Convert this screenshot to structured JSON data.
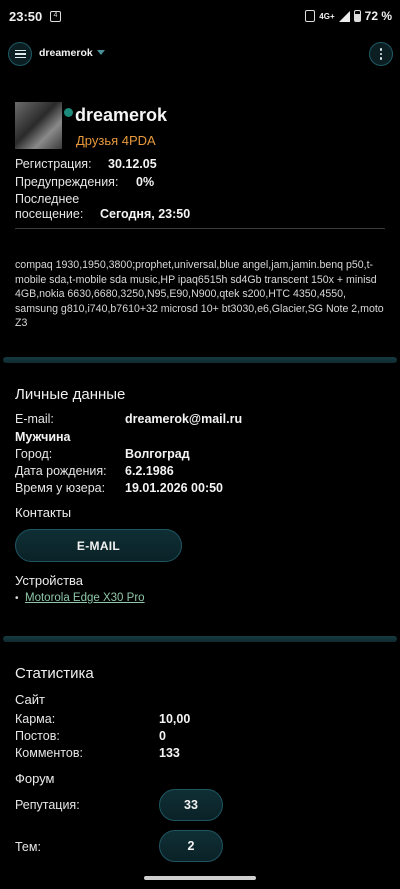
{
  "status_bar": {
    "time": "23:50",
    "network": "4G+",
    "battery": "72 %"
  },
  "app_bar": {
    "title": "dreamerok",
    "menu_icon": "hamburger-menu-icon",
    "more_icon": "more-vertical-icon"
  },
  "profile": {
    "username": "dreamerok",
    "group": "Друзья 4PDA",
    "group_color": "#e89a3c",
    "online_color": "#1b8a7a",
    "registration_label": "Регистрация:",
    "registration_value": "30.12.05",
    "warnings_label": "Предупреждения:",
    "warnings_value": "0%",
    "last_visit_label_1": "Последнее",
    "last_visit_label_2": "посещение:",
    "last_visit_value": "Сегодня, 23:50",
    "signature": "compaq 1930,1950,3800;prophet,universal,blue angel,jam,jamin.benq p50,t-mobile sda,t-mobile sda music,HP ipaq6515h sd4Gb transcent 150x + minisd 4GB,nokia 6630,6680,3250,N95,E90,N900,qtek s200,HTC 4350,4550, samsung g810,i740,b7610+32 microsd 10+ bt3030,e6,Glacier,SG Note 2,moto Z3"
  },
  "personal": {
    "title": "Личные данные",
    "email_label": "E-mail:",
    "email_value": "dreamerok@mail.ru",
    "gender": "Мужчина",
    "city_label": "Город:",
    "city_value": "Волгоград",
    "birthday_label": "Дата рождения:",
    "birthday_value": "6.2.1986",
    "usertime_label": "Время у юзера:",
    "usertime_value": "19.01.2026 00:50",
    "contacts_title": "Контакты",
    "email_button": "E-MAIL",
    "devices_title": "Устройства",
    "device": "Motorola Edge X30 Pro"
  },
  "stats": {
    "title": "Статистика",
    "site_title": "Сайт",
    "karma_label": "Карма:",
    "karma_value": "10,00",
    "posts_label": "Постов:",
    "posts_value": "0",
    "comments_label": "Комментов:",
    "comments_value": "133",
    "forum_title": "Форум",
    "reputation_label": "Репутация:",
    "reputation_value": "33",
    "topics_label": "Тем:",
    "topics_value": "2"
  },
  "colors": {
    "accent_border": "#1e5561",
    "separator": "#173a40",
    "link": "#8fc7a8"
  }
}
